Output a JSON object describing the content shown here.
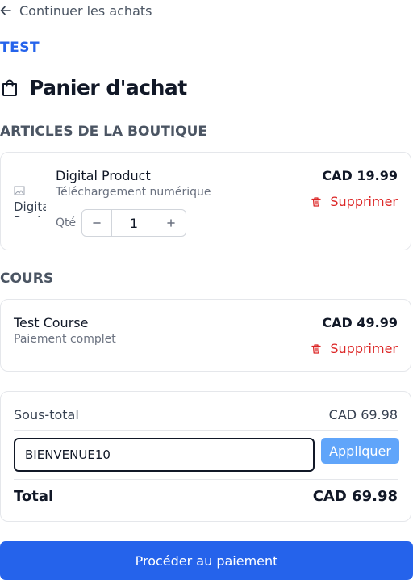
{
  "nav": {
    "back_label": "Continuer les achats"
  },
  "store": {
    "name": "TEST"
  },
  "page": {
    "title": "Panier d'achat"
  },
  "shop_section": {
    "title": "Articles de la boutique",
    "items": [
      {
        "img_alt": "Digital Product",
        "name": "Digital Product",
        "subtitle": "Téléchargement numérique",
        "price": "CAD 19.99",
        "qty_label": "Qté",
        "qty": "1",
        "remove_label": "Supprimer"
      }
    ]
  },
  "course_section": {
    "title": "Cours",
    "items": [
      {
        "name": "Test Course",
        "subtitle": "Paiement complet",
        "price": "CAD 49.99",
        "remove_label": "Supprimer"
      }
    ]
  },
  "summary": {
    "subtotal_label": "Sous-total",
    "subtotal_value": "CAD 69.98",
    "promo_code": "BIENVENUE10",
    "apply_label": "Appliquer",
    "total_label": "Total",
    "total_value": "CAD 69.98"
  },
  "checkout": {
    "label": "Procéder au paiement"
  },
  "colors": {
    "primary": "#2563eb",
    "apply_button": "#60a5fa",
    "danger": "#dc2626",
    "muted_text": "#6b7280"
  },
  "icons": {
    "back": "arrow-left-icon",
    "bag": "shopping-bag-icon",
    "remove": "trash-icon",
    "minus": "minus-icon",
    "plus": "plus-icon",
    "broken_image": "broken-image-icon"
  }
}
